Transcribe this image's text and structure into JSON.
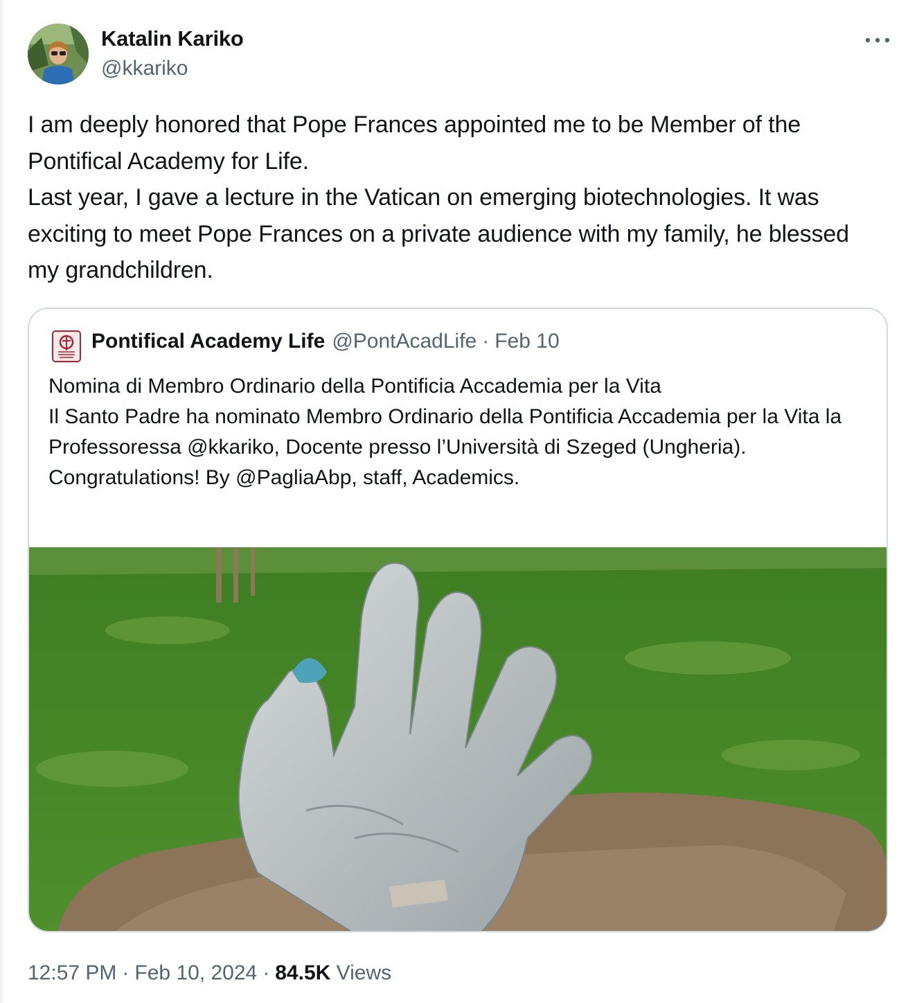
{
  "author": {
    "name": "Katalin Kariko",
    "handle": "@kkariko"
  },
  "tweet": {
    "text": "I am deeply honored that Pope Frances appointed me to be Member of the Pontifical Academy for Life.\nLast year, I gave a lecture in the Vatican on emerging biotechnologies. It was exciting to meet Pope Frances on a private audience with my family, he blessed my grandchildren."
  },
  "quote": {
    "name": "Pontifical Academy Life",
    "handle": "@PontAcadLife",
    "separator": "·",
    "date": "Feb 10",
    "text": "Nomina di Membro Ordinario della Pontificia Accademia per la Vita\nIl Santo Padre ha nominato Membro Ordinario della Pontificia Accademia per la Vita la  Professoressa @kkariko, Docente presso l’Università di Szeged (Ungheria).\n Congratulations! By @PagliaAbp, staff, Academics."
  },
  "meta": {
    "time": "12:57 PM",
    "separator": "·",
    "date": "Feb 10, 2024",
    "views_count": "84.5K",
    "views_label": "Views"
  },
  "icons": {
    "more": "more-dots-icon",
    "quote_logo": "pontifical-academy-logo"
  },
  "colors": {
    "text_primary": "#0f1419",
    "text_secondary": "#536471",
    "border": "#cfd9de"
  }
}
